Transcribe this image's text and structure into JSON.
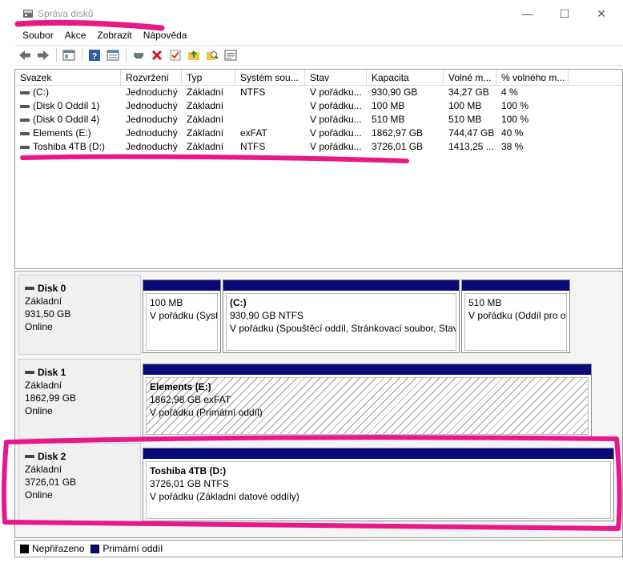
{
  "window": {
    "title": "Správa disků",
    "minimize_glyph": "—",
    "maximize_glyph": "☐",
    "close_glyph": "✕"
  },
  "menu": [
    "Soubor",
    "Akce",
    "Zobrazit",
    "Nápověda"
  ],
  "toolbar_icons": [
    "back-arrow-icon",
    "forward-arrow-icon",
    "console-tree-icon",
    "help-icon",
    "properties-icon",
    "connect-drive-icon",
    "delete-icon",
    "check-icon",
    "folder-up-icon",
    "search-icon",
    "console-view-icon"
  ],
  "volume_list": {
    "columns": [
      "Svazek",
      "Rozvržení",
      "Typ",
      "Systém sou...",
      "Stav",
      "Kapacita",
      "Volné m...",
      "% volného m..."
    ],
    "rows": [
      [
        "(C:)",
        "Jednoduchý",
        "Základní",
        "NTFS",
        "V pořádku...",
        "930,90 GB",
        "34,27 GB",
        "4 %"
      ],
      [
        "(Disk 0 Oddíl 1)",
        "Jednoduchý",
        "Základní",
        "",
        "V pořádku...",
        "100 MB",
        "100 MB",
        "100 %"
      ],
      [
        "(Disk 0 Oddíl 4)",
        "Jednoduchý",
        "Základní",
        "",
        "V pořádku...",
        "510 MB",
        "510 MB",
        "100 %"
      ],
      [
        "Elements (E:)",
        "Jednoduchý",
        "Základní",
        "exFAT",
        "V pořádku...",
        "1862,97 GB",
        "744,47 GB",
        "40 %"
      ],
      [
        "Toshiba 4TB (D:)",
        "Jednoduchý",
        "Základní",
        "NTFS",
        "V pořádku...",
        "3726,01 GB",
        "1413,25 ...",
        "38 %"
      ]
    ]
  },
  "disks": [
    {
      "name": "Disk 0",
      "type": "Základní",
      "size": "931,50 GB",
      "status": "Online",
      "partitions": [
        {
          "name": "",
          "size": "100 MB",
          "status": "V pořádku (Systém EFI oddíl)"
        },
        {
          "name": "(C:)",
          "size": "930,90 GB NTFS",
          "status": "V pořádku (Spouštěcí oddíl, Stránkovací soubor, Stav s"
        },
        {
          "name": "",
          "size": "510 MB",
          "status": "V pořádku (Oddíl pro o"
        }
      ]
    },
    {
      "name": "Disk 1",
      "type": "Základní",
      "size": "1862,99 GB",
      "status": "Online",
      "partitions": [
        {
          "name": "Elements  (E:)",
          "size": "1862,98 GB exFAT",
          "status": "V pořádku (Primární oddíl)"
        }
      ]
    },
    {
      "name": "Disk 2",
      "type": "Základní",
      "size": "3726,01 GB",
      "status": "Online",
      "partitions": [
        {
          "name": "Toshiba 4TB  (D:)",
          "size": "3726,01 GB NTFS",
          "status": "V pořádku (Základní datové oddíly)"
        }
      ]
    }
  ],
  "legend": [
    {
      "label": "Nepřiřazeno",
      "color": "#000000"
    },
    {
      "label": "Primární oddíl",
      "color": "#0a0a7a"
    }
  ],
  "annotation_color": "#e8178a"
}
